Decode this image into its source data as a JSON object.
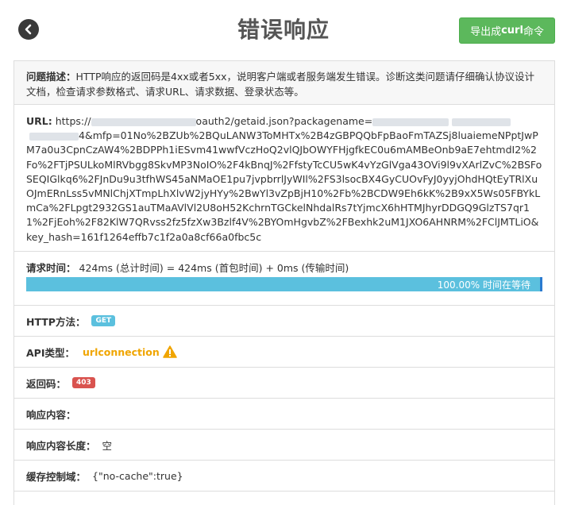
{
  "header": {
    "title": "错误响应",
    "export_label_prefix": "导出成",
    "export_label_bold": "curl",
    "export_label_suffix": "命令"
  },
  "description": {
    "label": "问题描述：",
    "text": "HTTP响应的返回码是4xx或者5xx，说明客户端或者服务端发生错误。诊断这类问题请仔细确认协议设计文档，检查请求参数格式、请求URL、请求数据、登录状态等。"
  },
  "url": {
    "label": "URL:",
    "prefix": "https://",
    "path": "oauth2/getaid.json?packagename=",
    "rest": "4&mfp=01No%2BZUb%2BQuLANW3ToMHTx%2B4zGBPQQbFpBaoFmTAZSj8luaiemeNPptJwPM7a0u3CpnCzAW4%2BDPPh1iESvm41wwfVczHoQ2vlQJbOWYFHjgfkEC0u6mAMBeOnb9aE7ehtmdI2%2Fo%2FTjPSULkoMlRVbgg8SkvMP3NoIO%2F4kBnqJ%2FfstyTcCU5wK4vYzGlVga43OVi9l9vXArlZvC%2BSFoSEQIGlkq6%2FJnDu9u3tfhWS45aNMaOE1pu7jvpbrrlJyWIl%2FS3lsocBX4GyCUOvFyJ0yyjOhdHQtEyTRlXuOJmERnLss5vMNlChjXTmpLhXlvW2jyHYy%2BwYl3vZpBjH10%2Fb%2BCDW9Eh6kK%2B9xX5Ws05FBYkLmCa%2FLpgt2932GS1auTMaAVlVl2U8oH52KchrnTGCkelNhdalRs7tYjmcX6hHTMJhyrDDGQ9GlzTS7qr11%2FjEoh%2F82KlW7QRvss2fz5fzXw3Bzlf4V%2BYOmHgvbZ%2FBexhk2uM1JXO6AHNRM%2FClJMTLiO&key_hash=161f1264effb7c1f2a0a8cf66a0fbc5c"
  },
  "timing": {
    "label": "请求时间：",
    "text": "424ms (总计时间) = 424ms (首包时间) + 0ms (传输时间)",
    "progress_percent": 100,
    "progress_text": "100.00% 时间在等待"
  },
  "fields": {
    "http_method_label": "HTTP方法：",
    "http_method_value": "GET",
    "api_type_label": "API类型：",
    "api_type_value": "urlconnection",
    "status_label": "返回码：",
    "status_value": "403",
    "body_label": "响应内容：",
    "body_value": "",
    "length_label": "响应内容长度：",
    "length_value": "空",
    "cache_label": "缓存控制域：",
    "cache_value": "{\"no-cache\":true}"
  },
  "colors": {
    "success": "#5cb85c",
    "info": "#5bc0de",
    "danger": "#d9534f",
    "warning": "#f0a500"
  },
  "icons": {
    "back": "arrow-left-circle-icon",
    "warning": "warning-triangle-icon"
  }
}
